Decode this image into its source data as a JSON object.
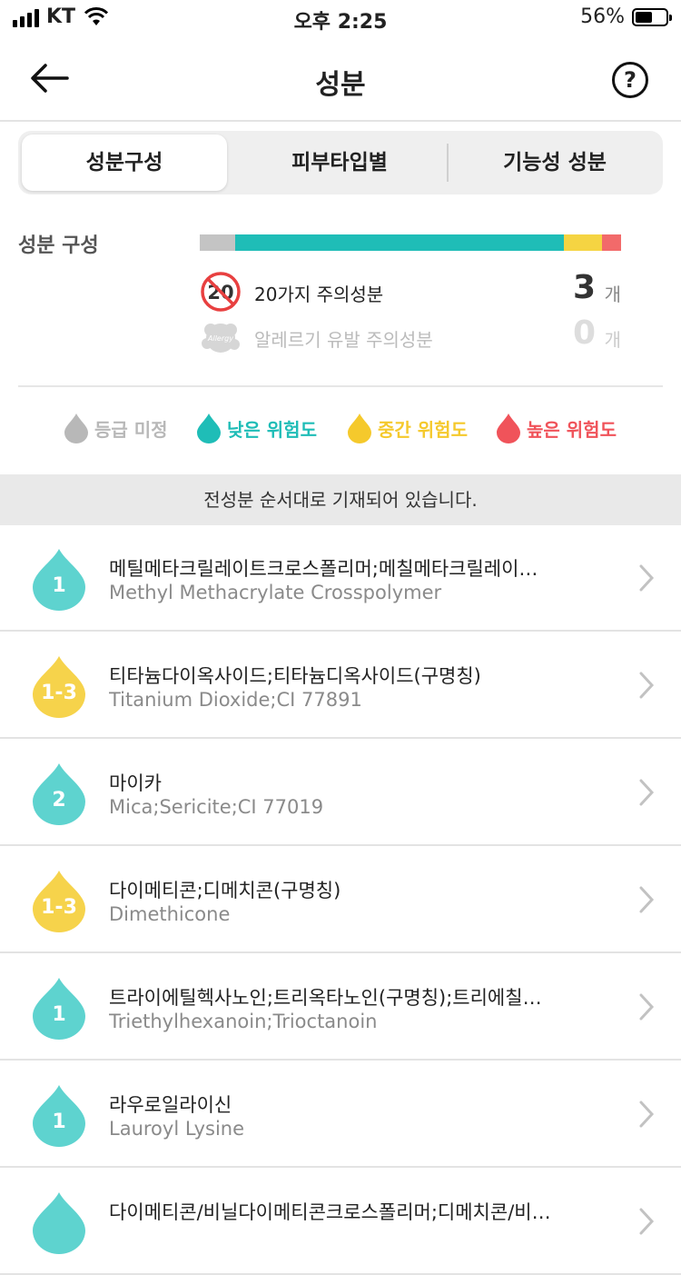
{
  "status_bar": {
    "carrier": "KT",
    "time": "오후 2:25",
    "battery": "56%",
    "battery_level": 0.56
  },
  "nav": {
    "title": "성분"
  },
  "tabs": [
    {
      "label": "성분구성",
      "active": true
    },
    {
      "label": "피부타입별",
      "active": false
    },
    {
      "label": "기능성 성분",
      "active": false
    }
  ],
  "composition": {
    "label": "성분 구성",
    "bar_shares": {
      "unrated": 0.085,
      "low": 0.78,
      "medium": 0.09,
      "high": 0.045
    },
    "warnings": [
      {
        "badge": "20",
        "text": "20가지 주의성분",
        "count": "3",
        "unit": "개"
      },
      {
        "badge": "Allergy",
        "text": "알레르기 유발 주의성분",
        "count": "0",
        "unit": "개"
      }
    ]
  },
  "legend": [
    {
      "label": "등급 미정",
      "color": "#b8b8b8"
    },
    {
      "label": "낮은 위험도",
      "color": "#1fbdb7"
    },
    {
      "label": "중간 위험도",
      "color": "#f5c92c"
    },
    {
      "label": "높은 위험도",
      "color": "#f0535a"
    }
  ],
  "notice": "전성분 순서대로 기재되어 있습니다.",
  "colors": {
    "low": "#5ed3cf",
    "medium": "#f6d34b",
    "bar_low": "#1fbdb7",
    "bar_medium": "#f5d442",
    "bar_high": "#f26a6a",
    "bar_unrated": "#c4c4c4"
  },
  "ingredients": [
    {
      "grade": "1",
      "level": "low",
      "name_ko": "메틸메타크릴레이트크로스폴리머;메칠메타크릴레이…",
      "name_en": "Methyl Methacrylate Crosspolymer"
    },
    {
      "grade": "1-3",
      "level": "medium",
      "name_ko": "티타늄다이옥사이드;티타늄디옥사이드(구명칭)",
      "name_en": "Titanium Dioxide;CI 77891"
    },
    {
      "grade": "2",
      "level": "low",
      "name_ko": "마이카",
      "name_en": "Mica;Sericite;CI 77019"
    },
    {
      "grade": "1-3",
      "level": "medium",
      "name_ko": "다이메티콘;디메치콘(구명칭)",
      "name_en": "Dimethicone"
    },
    {
      "grade": "1",
      "level": "low",
      "name_ko": "트라이에틸헥사노인;트리옥타노인(구명칭);트리에칠…",
      "name_en": "Triethylhexanoin;Trioctanoin"
    },
    {
      "grade": "1",
      "level": "low",
      "name_ko": "라우로일라이신",
      "name_en": "Lauroyl Lysine"
    },
    {
      "grade": "",
      "level": "low",
      "name_ko": "다이메티콘/비닐다이메티콘크로스폴리머;디메치콘/비…",
      "name_en": ""
    }
  ]
}
